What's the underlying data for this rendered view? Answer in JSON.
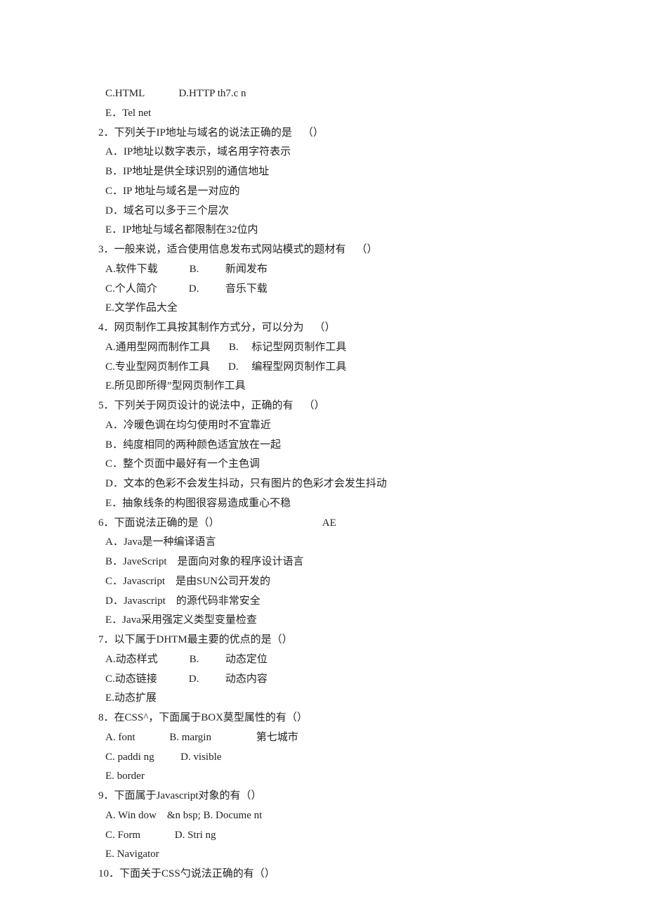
{
  "lines": [
    {
      "cls": "indent1",
      "text": "C.HTML             D.HTTP th7.c n"
    },
    {
      "cls": "indent1",
      "text": "E．Tel net"
    },
    {
      "cls": "",
      "text": "2．下列关于IP地址与域名的说法正确的是    （）"
    },
    {
      "cls": "indent1",
      "text": "A．IP地址以数字表示，域名用字符表示"
    },
    {
      "cls": "indent1",
      "text": "B．IP地址是供全球识别的通信地址"
    },
    {
      "cls": "indent1",
      "text": "C．IP 地址与域名是一对应的"
    },
    {
      "cls": "indent1",
      "text": "D．域名可以多于三个层次"
    },
    {
      "cls": "indent1",
      "text": "E．IP地址与域名都限制在32位内"
    },
    {
      "cls": "",
      "text": "3．一般来说，适合使用信息发布式网站模式的题材有    （）"
    },
    {
      "cls": "indent1",
      "text": "A.软件下载            B.          新闻发布"
    },
    {
      "cls": "indent1",
      "text": "C.个人简介            D.          音乐下载"
    },
    {
      "cls": "indent1",
      "text": "E.文学作品大全"
    },
    {
      "cls": "",
      "text": "4．网页制作工具按其制作方式分，可以分为    （）"
    },
    {
      "cls": "indent1",
      "text": "A.通用型网而制作工具       B.     标记型网页制作工具"
    },
    {
      "cls": "indent1",
      "text": "C.专业型网页制作工具       D.     编程型网页制作工具"
    },
    {
      "cls": "indent1",
      "text": "E.所见即所得”型网页制作工具"
    },
    {
      "cls": "",
      "text": "5．下列关于网页设计的说法中，正确的有    （）"
    },
    {
      "cls": "indent1",
      "text": "A．冷暖色调在均匀使用时不宜靠近"
    },
    {
      "cls": "indent1",
      "text": "B．纯度相同的两种颜色适宜放在一起"
    },
    {
      "cls": "indent1",
      "text": "C．整个页面中最好有一个主色调"
    },
    {
      "cls": "indent1",
      "text": "D．文本的色彩不会发生抖动，只有图片的色彩才会发生抖动"
    },
    {
      "cls": "indent1",
      "text": "E．抽象线条的构图很容易造成重心不稳"
    },
    {
      "cls": "",
      "text": "6．下面说法正确的是（）                                       AE"
    },
    {
      "cls": "indent1",
      "text": "A．Java是一种编译语言"
    },
    {
      "cls": "indent1",
      "text": "B．JaveScript    是面向对象的程序设计语言"
    },
    {
      "cls": "indent1",
      "text": "C．Javascript    是由SUN公司开发的"
    },
    {
      "cls": "indent1",
      "text": "D．Javascript    的源代码非常安全"
    },
    {
      "cls": "indent1",
      "text": "E．Java采用强定义类型变量检查"
    },
    {
      "cls": "",
      "text": "7．以下属于DHTM最主要的优点的是（）"
    },
    {
      "cls": "indent1",
      "text": "A.动态样式            B.          动态定位"
    },
    {
      "cls": "indent1",
      "text": "C.动态链接            D.          动态内容"
    },
    {
      "cls": "indent1",
      "text": "E.动态扩展"
    },
    {
      "cls": "",
      "text": "8．在CSS^，下面属于BOX莫型属性的有（）"
    },
    {
      "cls": "indent1",
      "text": "A. font             B. margin                 第七城市"
    },
    {
      "cls": "indent1",
      "text": "C. paddi ng          D. visible"
    },
    {
      "cls": "indent1",
      "text": "E. border"
    },
    {
      "cls": "",
      "text": "9．下面属于Javascript对象的有（）"
    },
    {
      "cls": "indent1",
      "text": "A. Win dow    &n bsp; B. Docume nt"
    },
    {
      "cls": "indent1",
      "text": "C. Form             D. Stri ng"
    },
    {
      "cls": "indent1",
      "text": "E. Navigator"
    },
    {
      "cls": "",
      "text": "10．下面关于CSS勺说法正确的有（）"
    }
  ]
}
